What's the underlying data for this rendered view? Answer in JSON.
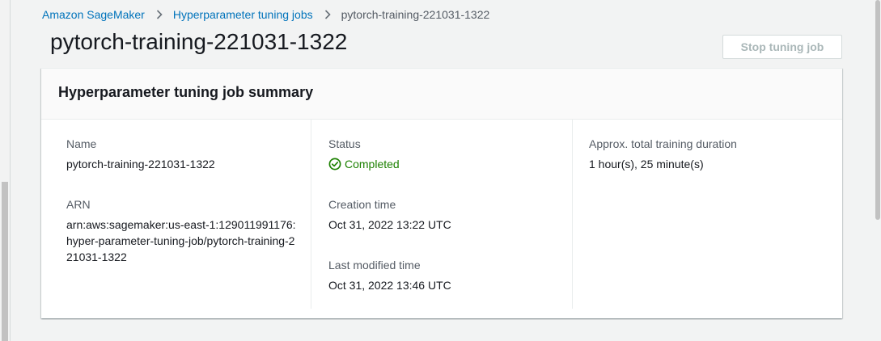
{
  "breadcrumb": {
    "items": [
      {
        "label": "Amazon SageMaker"
      },
      {
        "label": "Hyperparameter tuning jobs"
      },
      {
        "label": "pytorch-training-221031-1322"
      }
    ]
  },
  "page": {
    "title": "pytorch-training-221031-1322",
    "stop_button_label": "Stop tuning job"
  },
  "summary": {
    "header": "Hyperparameter tuning job summary",
    "name": {
      "label": "Name",
      "value": "pytorch-training-221031-1322"
    },
    "arn": {
      "label": "ARN",
      "value": "arn:aws:sagemaker:us-east-1:129011991176:hyper-parameter-tuning-job/pytorch-training-221031-1322"
    },
    "status": {
      "label": "Status",
      "value": "Completed",
      "icon": "check-circle-icon",
      "color": "#1d8102"
    },
    "creation_time": {
      "label": "Creation time",
      "value": "Oct 31, 2022 13:22 UTC"
    },
    "last_modified_time": {
      "label": "Last modified time",
      "value": "Oct 31, 2022 13:46 UTC"
    },
    "duration": {
      "label": "Approx. total training duration",
      "value": "1 hour(s), 25 minute(s)"
    }
  },
  "colors": {
    "link": "#0073bb",
    "background": "#f2f3f3",
    "text": "#16191f",
    "label": "#545b64",
    "disabled": "#aab7b8"
  }
}
